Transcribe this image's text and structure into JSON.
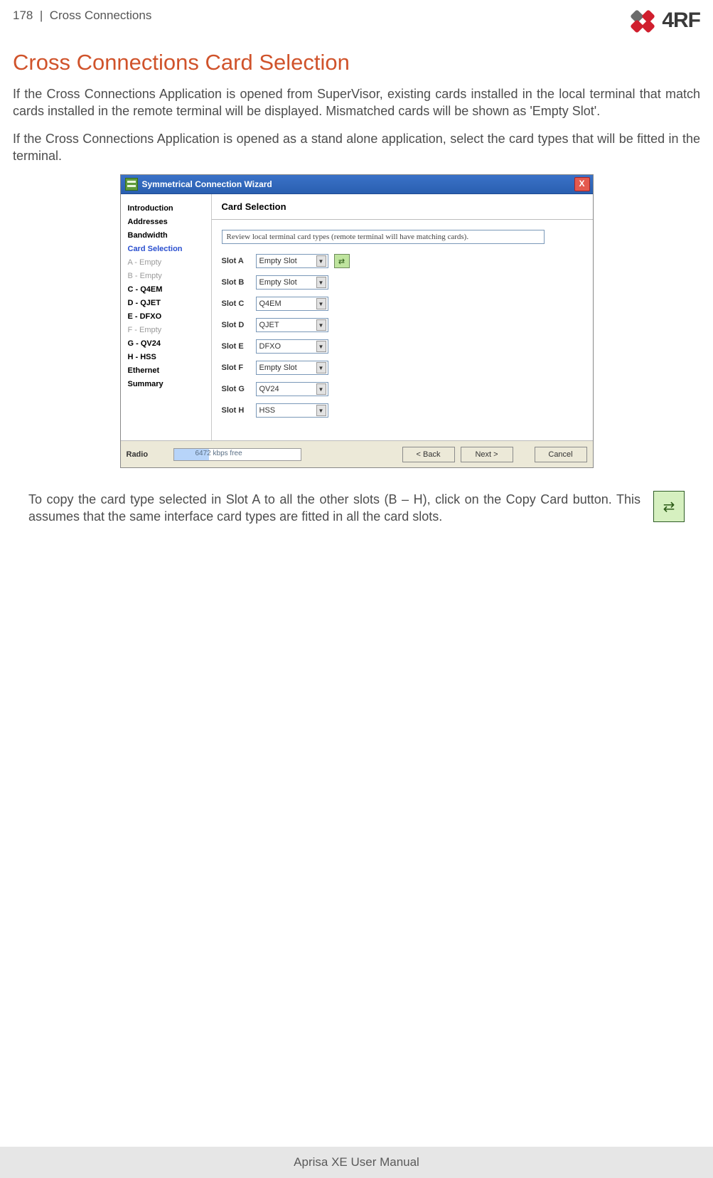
{
  "header": {
    "page_number": "178",
    "separator": "|",
    "section": "Cross Connections",
    "logo_text": "4RF"
  },
  "title": "Cross Connections Card Selection",
  "paragraphs": {
    "p1": "If the Cross Connections Application is opened from SuperVisor, existing cards installed in the local terminal that match cards installed in the remote terminal will be displayed. Mismatched cards will be shown as 'Empty Slot'.",
    "p2": "If the Cross Connections Application is opened as a stand alone application, select the card types that will be fitted in the terminal."
  },
  "wizard": {
    "title": "Symmetrical Connection Wizard",
    "close": "X",
    "heading": "Card Selection",
    "instruction": "Review local terminal card types (remote terminal will have matching cards).",
    "sidebar": {
      "items": [
        {
          "label": "Introduction",
          "cls": ""
        },
        {
          "label": "Addresses",
          "cls": ""
        },
        {
          "label": "Bandwidth",
          "cls": ""
        },
        {
          "label": "Card Selection",
          "cls": "blue"
        },
        {
          "label": "A - Empty",
          "cls": "grey"
        },
        {
          "label": "B - Empty",
          "cls": "grey"
        },
        {
          "label": "C - Q4EM",
          "cls": ""
        },
        {
          "label": "D - QJET",
          "cls": ""
        },
        {
          "label": "E - DFXO",
          "cls": ""
        },
        {
          "label": "F - Empty",
          "cls": "grey"
        },
        {
          "label": "G - QV24",
          "cls": ""
        },
        {
          "label": "H - HSS",
          "cls": ""
        },
        {
          "label": "Ethernet",
          "cls": ""
        },
        {
          "label": "Summary",
          "cls": ""
        }
      ]
    },
    "slots": [
      {
        "name": "Slot A",
        "value": "Empty Slot",
        "copy": true
      },
      {
        "name": "Slot B",
        "value": "Empty Slot"
      },
      {
        "name": "Slot C",
        "value": "Q4EM"
      },
      {
        "name": "Slot D",
        "value": "QJET"
      },
      {
        "name": "Slot E",
        "value": "DFXO"
      },
      {
        "name": "Slot F",
        "value": "Empty Slot"
      },
      {
        "name": "Slot G",
        "value": "QV24"
      },
      {
        "name": "Slot H",
        "value": "HSS"
      }
    ],
    "footer": {
      "radio_label": "Radio",
      "capacity_text": "6472 kbps free",
      "back": "< Back",
      "next": "Next >",
      "cancel": "Cancel"
    }
  },
  "copy_caption": "To copy the card type selected in Slot A to all the other slots (B – H), click on the Copy Card button. This assumes that the same interface card types are fitted in all the card slots.",
  "footer_text": "Aprisa XE User Manual"
}
